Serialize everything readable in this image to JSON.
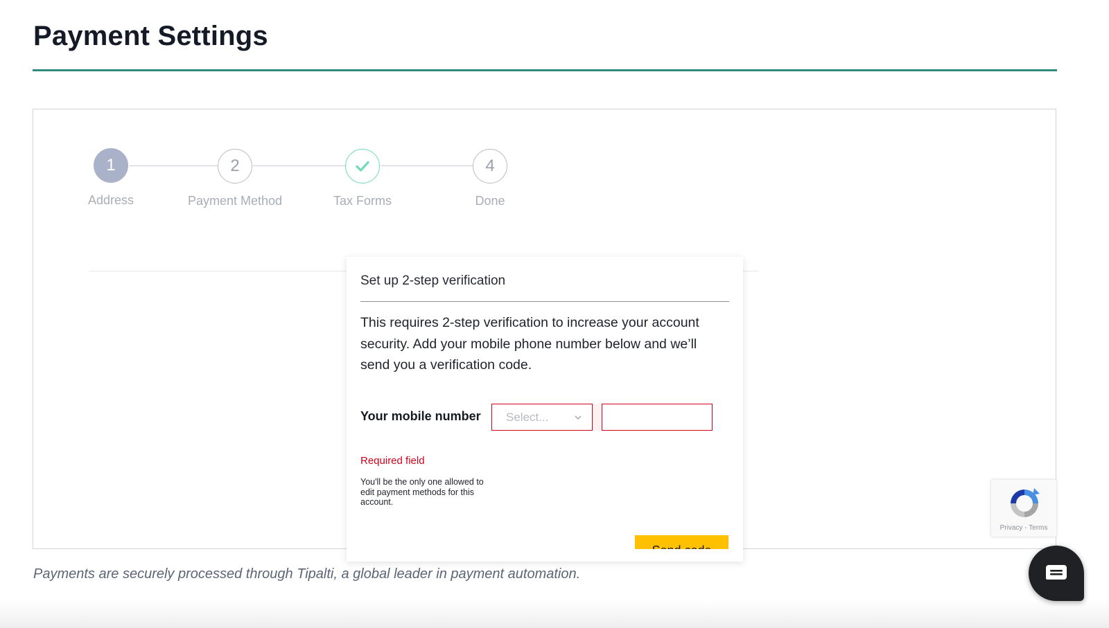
{
  "header": {
    "title": "Payment Settings"
  },
  "stepper": {
    "steps": [
      {
        "number": "1",
        "label": "Address",
        "state": "active"
      },
      {
        "number": "2",
        "label": "Payment Method",
        "state": "pending"
      },
      {
        "number": "",
        "label": "Tax Forms",
        "state": "completed"
      },
      {
        "number": "4",
        "label": "Done",
        "state": "pending"
      }
    ]
  },
  "modal": {
    "title": "Set up 2-step verification",
    "description": "This requires 2-step verification to increase your account security. Add your mobile phone number below and we’ll send you a verification code.",
    "mobile_label": "Your mobile number",
    "country_select_placeholder": "Select...",
    "phone_value": "",
    "error": "Required field",
    "help": "You'll be the only one allowed to edit payment methods for this account.",
    "send_button": "Send code"
  },
  "footer": {
    "text": "Payments are securely processed through Tipalti, a global leader in payment automation."
  },
  "recaptcha": {
    "privacy": "Privacy",
    "separator": "-",
    "terms": "Terms"
  },
  "colors": {
    "accent_rule": "#2f8a80",
    "active_step": "#a9b2c9",
    "completed_step": "#6fdcb6",
    "error": "#d0021b",
    "button": "#ffc000"
  },
  "icons": {
    "step3": "check-icon",
    "select": "chevron-down-icon",
    "recaptcha": "recaptcha-logo-icon",
    "chat": "chat-bubble-icon"
  }
}
